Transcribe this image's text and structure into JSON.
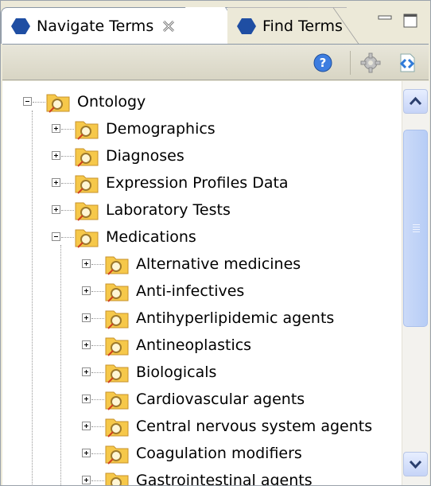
{
  "tabs": [
    {
      "label": "Navigate Terms",
      "active": true,
      "icon": "hexagon-icon"
    },
    {
      "label": "Find Terms",
      "active": false,
      "icon": "hexagon-icon"
    }
  ],
  "toolbar": {
    "buttons": [
      "help-icon",
      "settings-icon",
      "sync-icon"
    ]
  },
  "tree": [
    {
      "label": "Ontology",
      "depth": 0,
      "expanded": true
    },
    {
      "label": "Demographics",
      "depth": 1,
      "expanded": false
    },
    {
      "label": "Diagnoses",
      "depth": 1,
      "expanded": false
    },
    {
      "label": "Expression Profiles Data",
      "depth": 1,
      "expanded": false
    },
    {
      "label": "Laboratory Tests",
      "depth": 1,
      "expanded": false
    },
    {
      "label": "Medications",
      "depth": 1,
      "expanded": true
    },
    {
      "label": "Alternative medicines",
      "depth": 2,
      "expanded": false
    },
    {
      "label": "Anti-infectives",
      "depth": 2,
      "expanded": false
    },
    {
      "label": "Antihyperlipidemic agents",
      "depth": 2,
      "expanded": false
    },
    {
      "label": "Antineoplastics",
      "depth": 2,
      "expanded": false
    },
    {
      "label": "Biologicals",
      "depth": 2,
      "expanded": false
    },
    {
      "label": "Cardiovascular agents",
      "depth": 2,
      "expanded": false
    },
    {
      "label": "Central nervous system agents",
      "depth": 2,
      "expanded": false
    },
    {
      "label": "Coagulation modifiers",
      "depth": 2,
      "expanded": false
    },
    {
      "label": "Gastrointestinal agents",
      "depth": 2,
      "expanded": false
    }
  ],
  "colors": {
    "folder": "#f6c84a",
    "hexagon": "#1f4ea3",
    "scrollbar": "#c6d4f7"
  }
}
